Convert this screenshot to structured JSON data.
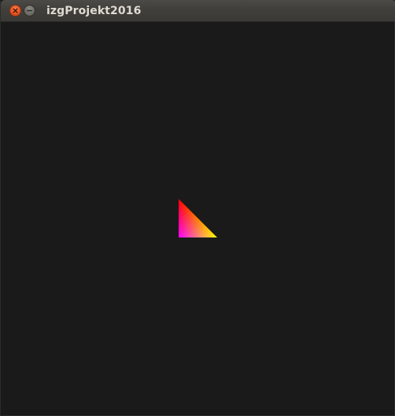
{
  "window": {
    "title": "izgProjekt2016",
    "buttons": {
      "close_icon": "close-icon",
      "minimize_icon": "minimize-icon"
    }
  },
  "colors": {
    "canvas_background": "#1a1a1a",
    "close_button": "#e95420",
    "minimize_button": "#6c6b66",
    "title_text": "#dfdbd2",
    "triangle_vertex_top": "#ff0000",
    "triangle_vertex_bottom_left": "#0000ff",
    "triangle_vertex_bottom_right": "#00ff00"
  }
}
